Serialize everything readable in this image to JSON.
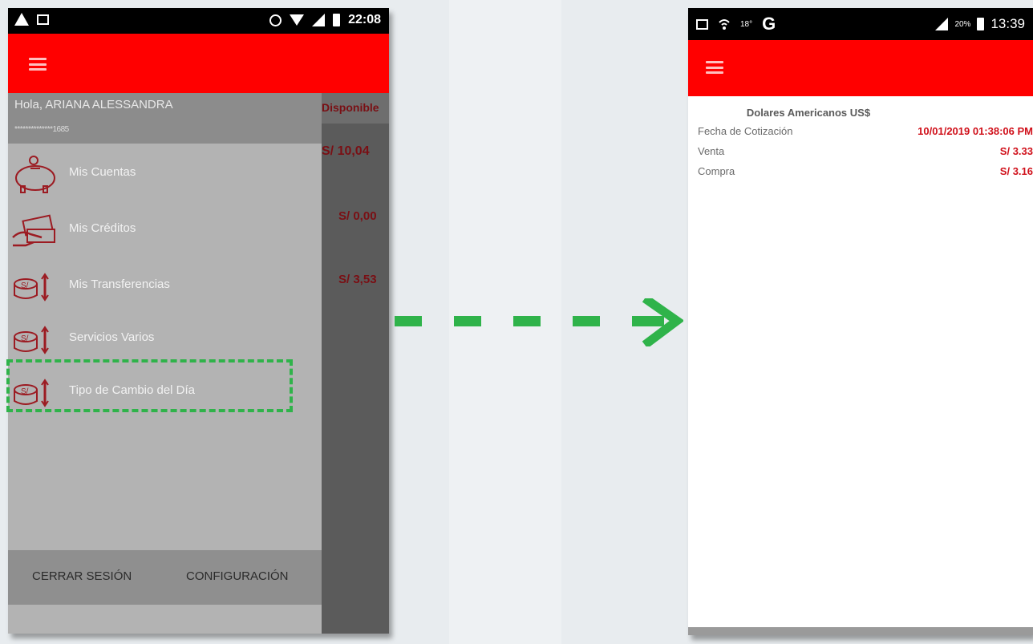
{
  "left_phone": {
    "status_bar": {
      "time": "22:08",
      "icons": [
        "warning-icon",
        "image-icon",
        "alarm-icon",
        "wifi-icon",
        "signal-icon",
        "battery-icon"
      ]
    },
    "drawer": {
      "greeting": "Hola, ARIANA ALESSANDRA",
      "account_masked": "**************1685",
      "menu_items": [
        {
          "label": "Mis Cuentas",
          "icon": "piggy-bank-icon"
        },
        {
          "label": "Mis Créditos",
          "icon": "money-hand-icon"
        },
        {
          "label": "Mis Transferencias",
          "icon": "coins-transfer-icon"
        },
        {
          "label": "Servicios Varios",
          "icon": "coins-transfer-icon"
        },
        {
          "label": "Tipo de Cambio del Día",
          "icon": "coins-transfer-icon"
        }
      ],
      "footer": {
        "logout": "CERRAR SESIÓN",
        "settings": "CONFIGURACIÓN"
      }
    },
    "background": {
      "header": "Disponible",
      "balances": [
        "S/ 10,04",
        "S/ 0,00",
        "S/ 3,53"
      ]
    }
  },
  "right_phone": {
    "status_bar": {
      "time": "13:39",
      "battery": "20%",
      "temp": "18°",
      "icons": [
        "gallery-icon",
        "wifi-call-icon",
        "g-letter-icon",
        "signal-icon",
        "battery-icon"
      ]
    },
    "currency_title": "Dolares Americanos US$",
    "rows": [
      {
        "label": "Fecha de Cotización",
        "value": "10/01/2019 01:38:06 PM"
      },
      {
        "label": "Venta",
        "value": "S/  3.33"
      },
      {
        "label": "Compra",
        "value": "S/  3.16"
      }
    ]
  },
  "colors": {
    "brand_red": "#ff0000",
    "highlight_green": "#2fb34a",
    "value_red": "#d0101a"
  }
}
